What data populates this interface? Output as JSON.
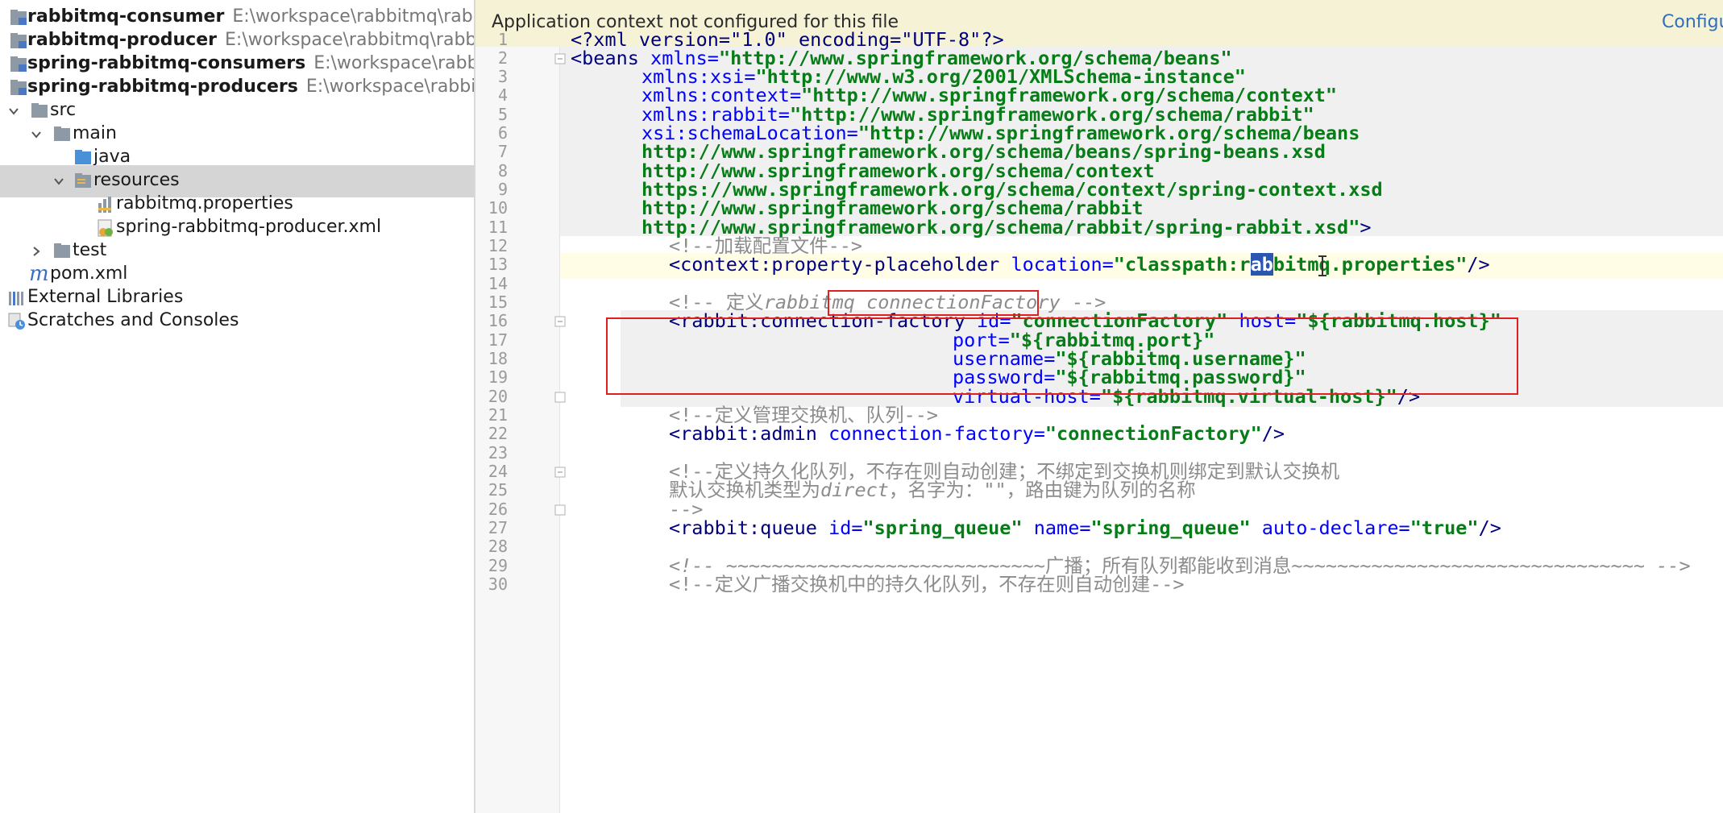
{
  "project_tree": {
    "items": [
      {
        "name": "rabbitmq-consumer",
        "path": "E:\\workspace\\rabbitmq\\rab"
      },
      {
        "name": "rabbitmq-producer",
        "path": "E:\\workspace\\rabbitmq\\rabb"
      },
      {
        "name": "spring-rabbitmq-consumers",
        "path": "E:\\workspace\\rabb"
      },
      {
        "name": "spring-rabbitmq-producers",
        "path": "E:\\workspace\\rabbit"
      },
      {
        "name": "src"
      },
      {
        "name": "main"
      },
      {
        "name": "java"
      },
      {
        "name": "resources"
      },
      {
        "name": "rabbitmq.properties"
      },
      {
        "name": "spring-rabbitmq-producer.xml"
      },
      {
        "name": "test"
      },
      {
        "name": "pom.xml"
      },
      {
        "name": "External Libraries"
      },
      {
        "name": "Scratches and Consoles"
      }
    ]
  },
  "editor": {
    "banner_message": "Application context not configured for this file",
    "banner_link": "Configu",
    "line_numbers": [
      "1",
      "2",
      "3",
      "4",
      "5",
      "6",
      "7",
      "8",
      "9",
      "10",
      "11",
      "12",
      "13",
      "14",
      "15",
      "16",
      "17",
      "18",
      "19",
      "20",
      "21",
      "22",
      "23",
      "24",
      "25",
      "26",
      "27",
      "28",
      "29",
      "30"
    ],
    "code": {
      "l1": "<?xml version=\"1.0\" encoding=\"UTF-8\"?>",
      "l2_tag": "<beans ",
      "l2_attr": "xmlns",
      "l2_val": "\"http://www.springframework.org/schema/beans\"",
      "l3_attr": "xmlns:xsi",
      "l3_val": "\"http://www.w3.org/2001/XMLSchema-instance\"",
      "l4_attr": "xmlns:context",
      "l4_val": "\"http://www.springframework.org/schema/context\"",
      "l5_attr": "xmlns:rabbit",
      "l5_val": "\"http://www.springframework.org/schema/rabbit\"",
      "l6_attr": "xsi:schemaLocation",
      "l6_val": "\"http://www.springframework.org/schema/beans",
      "l7": "http://www.springframework.org/schema/beans/spring-beans.xsd",
      "l8": "http://www.springframework.org/schema/context",
      "l9": "https://www.springframework.org/schema/context/spring-context.xsd",
      "l10": "http://www.springframework.org/schema/rabbit",
      "l11": "http://www.springframework.org/schema/rabbit/spring-rabbit.xsd\"",
      "l12": "<!--加载配置文件-->",
      "l13_tag": "<context:property-placeholder ",
      "l13_attr": "location",
      "l13_val_a": "\"classpath:r",
      "l13_val_sel": "ab",
      "l13_val_b": "bitmq.properties\"",
      "l15_a": "<!-- 定义",
      "l15_b": "rabbitmq ",
      "l15_c": "connectionFactory",
      "l15_d": " -->",
      "l16_tag": "<rabbit:connection-factory ",
      "l16_attr1": "id",
      "l16_val1": "\"connectionFactory\"",
      "l16_attr2": "host",
      "l16_val2": "\"${rabbitmq.host}\"",
      "l17_attr": "port",
      "l17_val": "\"${rabbitmq.port}\"",
      "l18_attr": "username",
      "l18_val": "\"${rabbitmq.username}\"",
      "l19_attr": "password",
      "l19_val": "\"${rabbitmq.password}\"",
      "l20_attr": "virtual-host",
      "l20_val": "\"${rabbitmq.virtual-host}\"",
      "l21": "<!--定义管理交换机、队列-->",
      "l22_tag": "<rabbit:admin ",
      "l22_attr": "connection-factory",
      "l22_val": "\"connectionFactory\"",
      "l24": "<!--定义持久化队列，不存在则自动创建；不绑定到交换机则绑定到默认交换机",
      "l25_a": "默认交换机类型为",
      "l25_b": "direct",
      "l25_c": "，名字为：\"\"，路由键为队列的名称",
      "l26": "-->",
      "l27_tag": "<rabbit:queue ",
      "l27_attr1": "id",
      "l27_val1": "\"spring_queue\"",
      "l27_attr2": "name",
      "l27_val2": "\"spring_queue\"",
      "l27_attr3": "auto-declare",
      "l27_val3": "\"true\"",
      "l29_a": "<!-- ",
      "l29_b": "~~~~~~~~~~~~~~~~~~~~~~~~~~~~",
      "l29_c": "广播；所有队列都能收到消息",
      "l29_d": "~~~~~~~~~~~~~~~~~~~~~~~~~~~~~~~ -->",
      "l30": "<!--定义广播交换机中的持久化队列，不存在则自动创建-->",
      "close_tag": ">",
      "self_close": "/>",
      "eq": "="
    }
  },
  "colors": {
    "tag": "#00007f",
    "attribute": "#0000ff",
    "value": "#067d17",
    "comment": "#8c8c8c",
    "highlight_box": "#e02020",
    "selection": "#2a56b0"
  }
}
